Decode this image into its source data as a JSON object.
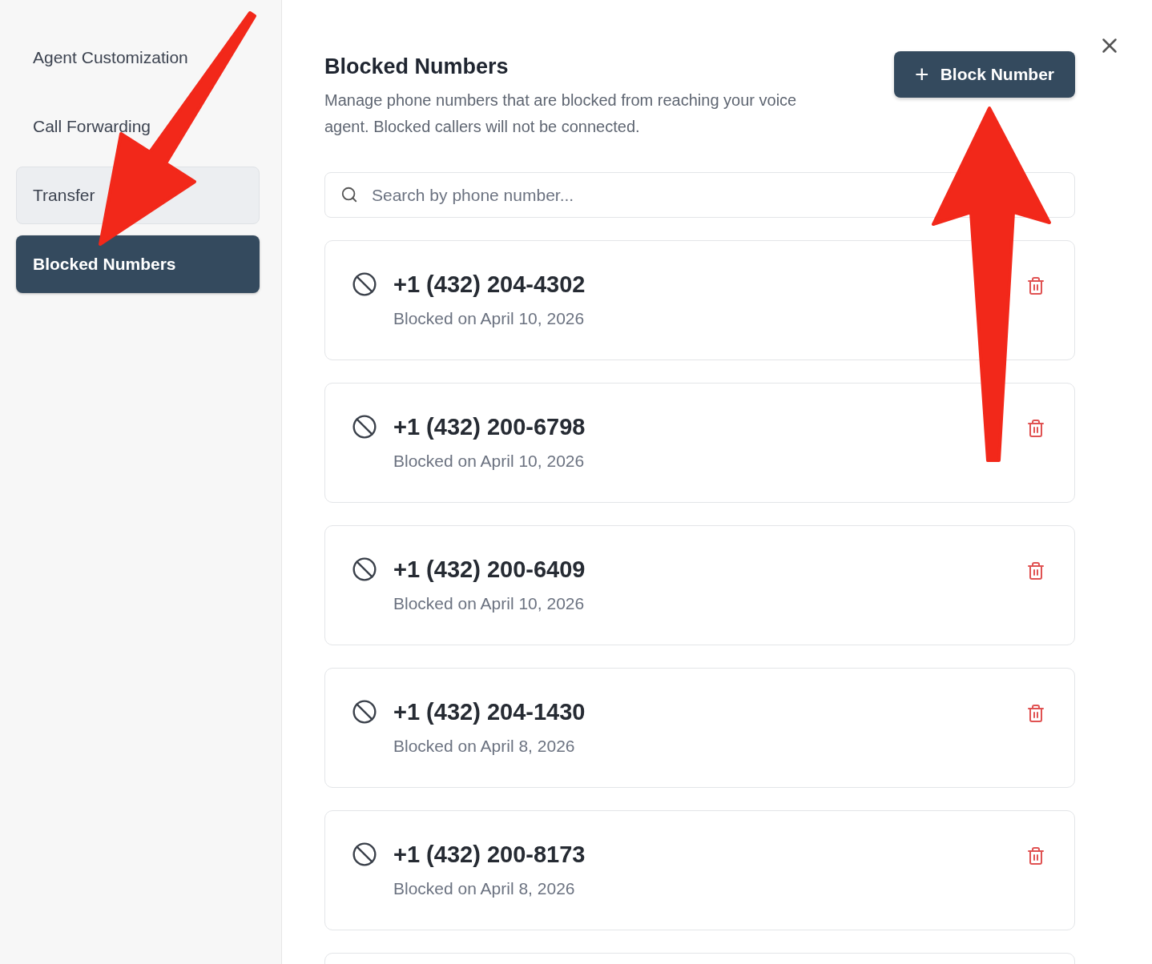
{
  "sidebar": {
    "items": [
      {
        "label": "Agent Customization",
        "selected": false,
        "highlighted": false
      },
      {
        "label": "Call Forwarding",
        "selected": false,
        "highlighted": false
      },
      {
        "label": "Transfer",
        "selected": false,
        "highlighted": true
      },
      {
        "label": "Blocked Numbers",
        "selected": true,
        "highlighted": false
      }
    ]
  },
  "header": {
    "title": "Blocked Numbers",
    "description": "Manage phone numbers that are blocked from reaching your voice agent. Blocked callers will not be connected.",
    "button": {
      "icon": "+",
      "label": "Block Number"
    }
  },
  "search": {
    "placeholder": "Search by phone number..."
  },
  "blocked_numbers": [
    {
      "number": "+1 (432) 204-4302",
      "date": "Blocked on April 10, 2026"
    },
    {
      "number": "+1 (432) 200-6798",
      "date": "Blocked on April 10, 2026"
    },
    {
      "number": "+1 (432) 200-6409",
      "date": "Blocked on April 10, 2026"
    },
    {
      "number": "+1 (432) 204-1430",
      "date": "Blocked on April 8, 2026"
    },
    {
      "number": "+1 (432) 200-8173",
      "date": "Blocked on April 8, 2026"
    }
  ]
}
